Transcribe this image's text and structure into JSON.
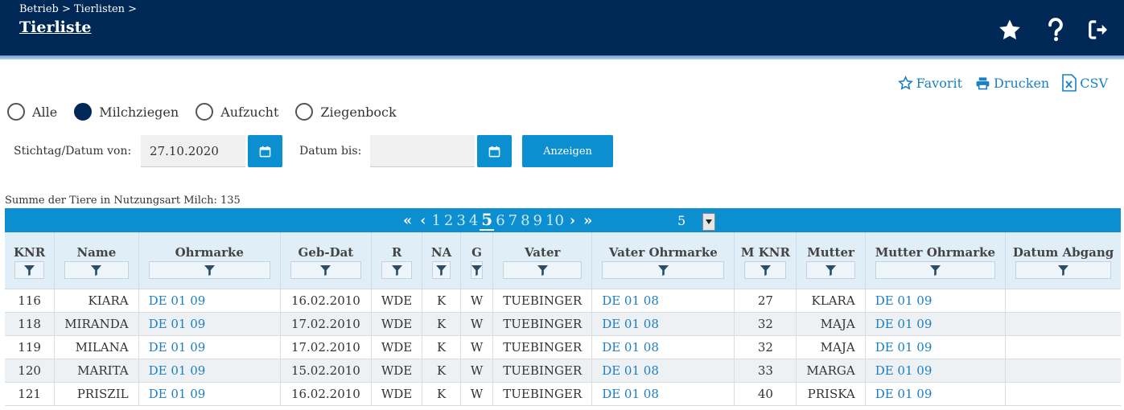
{
  "header": {
    "breadcrumb": "Betrieb > Tierlisten >",
    "title": "Tierliste",
    "icons": [
      "star-icon",
      "question-icon",
      "logout-icon"
    ]
  },
  "actions": {
    "favorit": "Favorit",
    "drucken": "Drucken",
    "csv": "CSV"
  },
  "filters": {
    "radios": [
      {
        "label": "Alle",
        "selected": false
      },
      {
        "label": "Milchziegen",
        "selected": true
      },
      {
        "label": "Aufzucht",
        "selected": false
      },
      {
        "label": "Ziegenbock",
        "selected": false
      }
    ],
    "date_from_label": "Stichtag/Datum von:",
    "date_from_value": "27.10.2020",
    "date_to_label": "Datum bis:",
    "date_to_value": "",
    "show_button": "Anzeigen"
  },
  "summary": "Summe der Tiere in Nutzungsart Milch: 135",
  "pagination": {
    "first": "«",
    "prev": "‹",
    "pages": [
      "1",
      "2",
      "3",
      "4",
      "5",
      "6",
      "7",
      "8",
      "9",
      "10"
    ],
    "current": "5",
    "next": "›",
    "last": "»",
    "page_size": "5"
  },
  "table": {
    "columns": [
      "KNR",
      "Name",
      "Ohrmarke",
      "Geb-Dat",
      "R",
      "NA",
      "G",
      "Vater",
      "Vater Ohrmarke",
      "M KNR",
      "Mutter",
      "Mutter Ohrmarke",
      "Datum Abgang"
    ],
    "rows": [
      [
        "116",
        "KIARA",
        "DE 01 09",
        "16.02.2010",
        "WDE",
        "K",
        "W",
        "TUEBINGER",
        "DE 01 08",
        "27",
        "KLARA",
        "DE 01 09",
        ""
      ],
      [
        "118",
        "MIRANDA",
        "DE 01 09",
        "17.02.2010",
        "WDE",
        "K",
        "W",
        "TUEBINGER",
        "DE 01 08",
        "32",
        "MAJA",
        "DE 01 09",
        ""
      ],
      [
        "119",
        "MILANA",
        "DE 01 09",
        "17.02.2010",
        "WDE",
        "K",
        "W",
        "TUEBINGER",
        "DE 01 08",
        "32",
        "MAJA",
        "DE 01 09",
        ""
      ],
      [
        "120",
        "MARITA",
        "DE 01 09",
        "15.02.2010",
        "WDE",
        "K",
        "W",
        "TUEBINGER",
        "DE 01 08",
        "33",
        "MARGA",
        "DE 01 09",
        ""
      ],
      [
        "121",
        "PRISZIL",
        "DE 01 09",
        "16.02.2010",
        "WDE",
        "K",
        "W",
        "TUEBINGER",
        "DE 01 08",
        "40",
        "PRISKA",
        "DE 01 09",
        ""
      ]
    ]
  },
  "colors": {
    "header_bg": "#002856",
    "accent": "#0b8fd0",
    "link": "#1a7fc4"
  }
}
